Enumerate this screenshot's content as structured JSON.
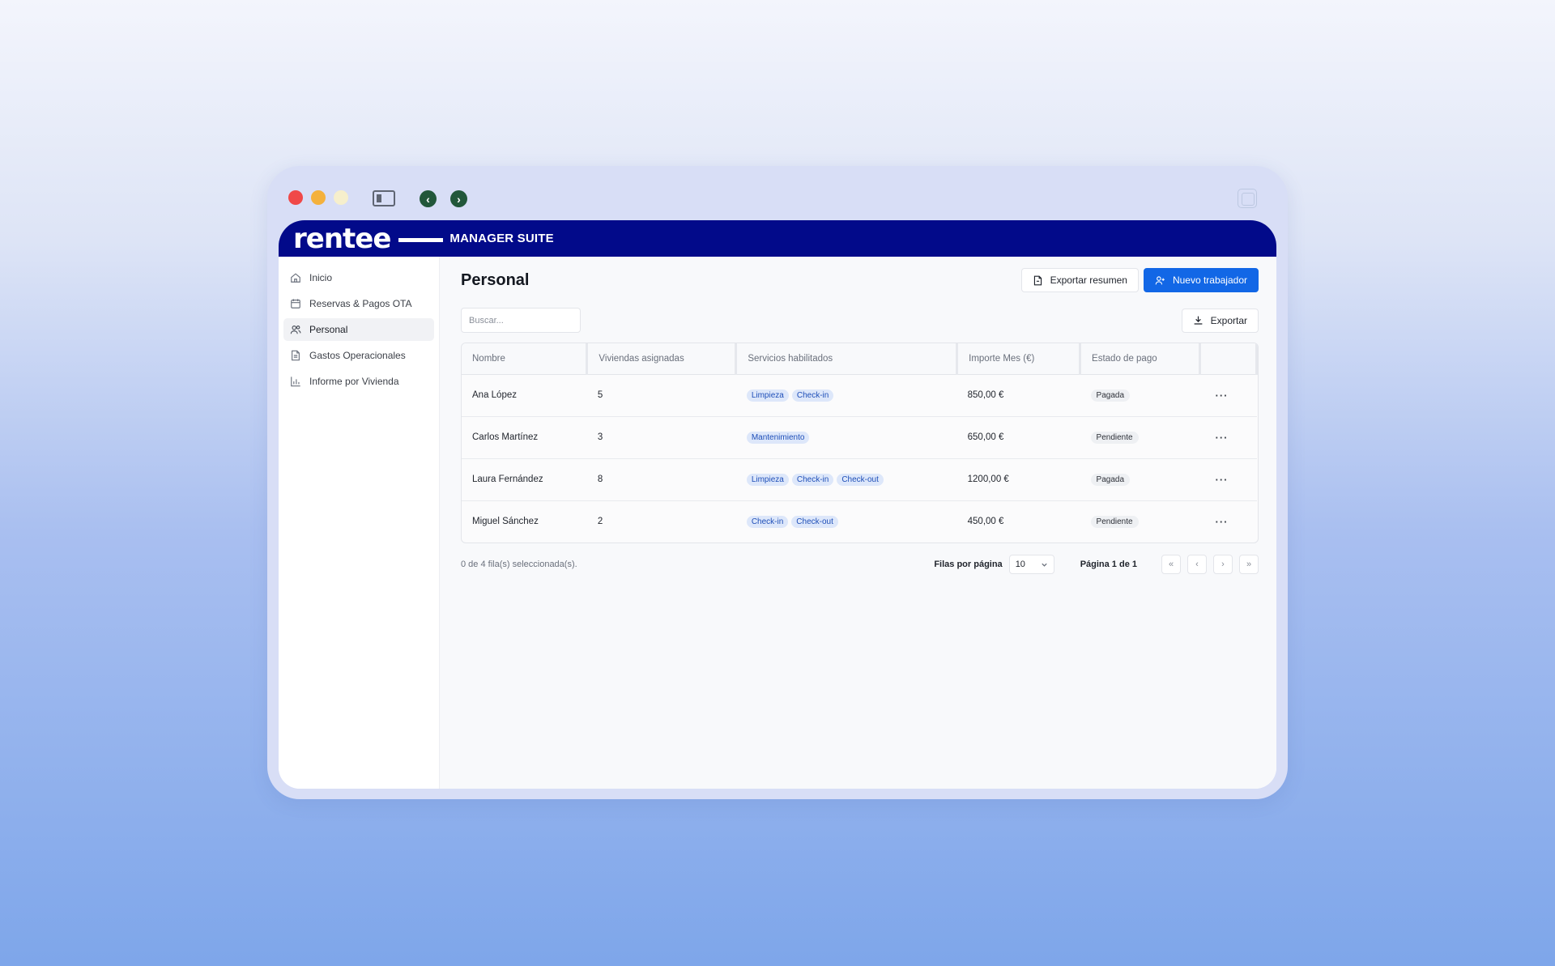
{
  "window": {
    "controls": [
      "close-icon",
      "minimize-icon",
      "maximize-icon"
    ],
    "icons": {
      "sidebar_toggle": "sidebar-icon",
      "back": "chevron-left-icon",
      "forward": "chevron-right-icon",
      "copy": "copy-icon"
    }
  },
  "header": {
    "logo": "rentee",
    "suite": "MANAGER SUITE",
    "color": "#020a8a"
  },
  "sidebar": {
    "items": [
      {
        "label": "Inicio",
        "icon": "home-icon"
      },
      {
        "label": "Reservas & Pagos OTA",
        "icon": "calendar-icon"
      },
      {
        "label": "Personal",
        "icon": "users-icon",
        "active": true
      },
      {
        "label": "Gastos Operacionales",
        "icon": "document-icon"
      },
      {
        "label": "Informe por Vivienda",
        "icon": "bar-chart-icon"
      }
    ]
  },
  "page": {
    "title": "Personal",
    "export_summary_label": "Exportar resumen",
    "new_worker_label": "Nuevo trabajador",
    "export_label": "Exportar",
    "search_placeholder": "Buscar...",
    "accent": "#1267e6"
  },
  "table": {
    "columns": [
      "Nombre",
      "Viviendas asignadas",
      "Servicios habilitados",
      "Importe Mes (€)",
      "Estado de pago",
      ""
    ],
    "rows": [
      {
        "name": "Ana López",
        "homes": "5",
        "services": [
          "Limpieza",
          "Check-in"
        ],
        "amount": "850,00 €",
        "status": "Pagada"
      },
      {
        "name": "Carlos Martínez",
        "homes": "3",
        "services": [
          "Mantenimiento"
        ],
        "amount": "650,00 €",
        "status": "Pendiente"
      },
      {
        "name": "Laura Fernández",
        "homes": "8",
        "services": [
          "Limpieza",
          "Check-in",
          "Check-out"
        ],
        "amount": "1200,00 €",
        "status": "Pagada"
      },
      {
        "name": "Miguel Sánchez",
        "homes": "2",
        "services": [
          "Check-in",
          "Check-out"
        ],
        "amount": "450,00 €",
        "status": "Pendiente"
      }
    ],
    "row_action": "···"
  },
  "footer": {
    "selection": "0 de 4 fila(s) seleccionada(s).",
    "rows_per_page_label": "Filas por página",
    "rows_per_page_value": "10",
    "page_label": "Página 1 de 1"
  }
}
